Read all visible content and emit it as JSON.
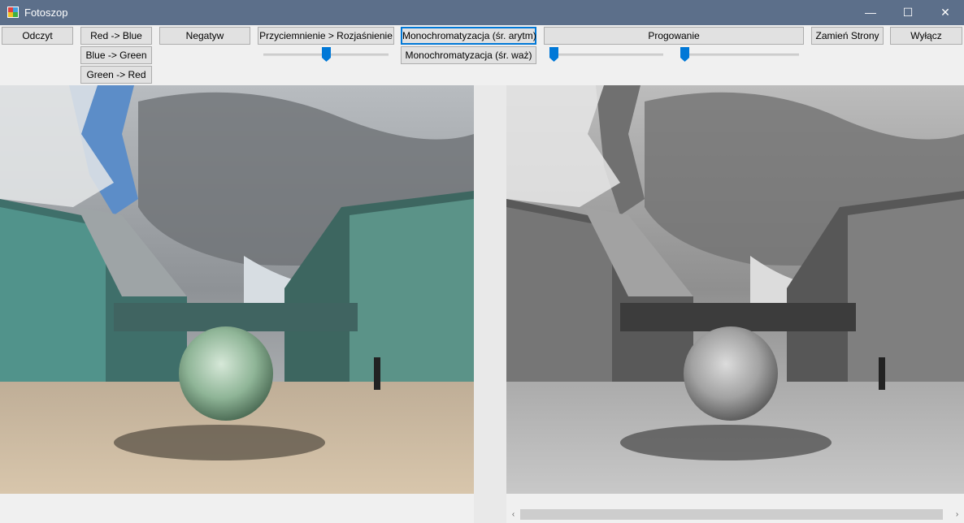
{
  "window": {
    "title": "Fotoszop",
    "minimize_glyph": "—",
    "maximize_glyph": "☐",
    "close_glyph": "✕"
  },
  "toolbar": {
    "odczyt": "Odczyt",
    "red_blue": "Red -> Blue",
    "blue_green": "Blue -> Green",
    "green_red": "Green -> Red",
    "negatyw": "Negatyw",
    "brightness": "Przyciemnienie > Rozjaśnienie",
    "mono_arith": "Monochromatyzacja (śr. arytm)",
    "mono_weighted": "Monochromatyzacja (śr. waż)",
    "progowanie": "Progowanie",
    "zamien": "Zamień Strony",
    "wylacz": "Wyłącz"
  },
  "sliders": {
    "brightness_level": 0.5,
    "threshold_low_level": 0.0,
    "threshold_high_level": 0.0
  },
  "scrollbar": {
    "left_arrow": "‹",
    "right_arrow": "›"
  },
  "colors": {
    "titlebar": "#5c6f8a",
    "accent": "#0078d7"
  }
}
